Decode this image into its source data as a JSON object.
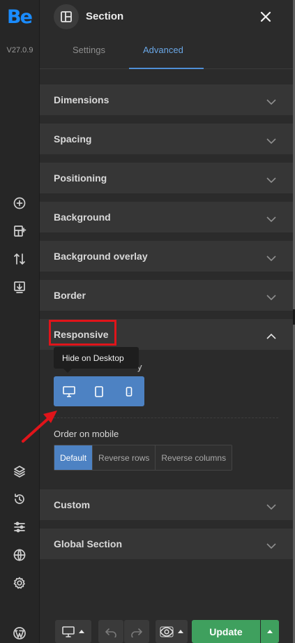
{
  "app": {
    "logo": "Be",
    "version": "V27.0.9"
  },
  "panel": {
    "title": "Section",
    "tabs": [
      {
        "label": "Settings",
        "active": false
      },
      {
        "label": "Advanced",
        "active": true
      }
    ],
    "sections": [
      {
        "label": "Dimensions",
        "expanded": false
      },
      {
        "label": "Spacing",
        "expanded": false
      },
      {
        "label": "Positioning",
        "expanded": false
      },
      {
        "label": "Background",
        "expanded": false
      },
      {
        "label": "Background overlay",
        "expanded": false
      },
      {
        "label": "Border",
        "expanded": false
      },
      {
        "label": "Responsive",
        "expanded": true
      },
      {
        "label": "Custom",
        "expanded": false
      },
      {
        "label": "Global Section",
        "expanded": false
      }
    ],
    "responsive": {
      "tooltip": "Hide on Desktop",
      "visibility_label_tail": "y",
      "devices": [
        "desktop",
        "tablet",
        "mobile"
      ],
      "order_label": "Order on mobile",
      "order_options": [
        "Default",
        "Reverse rows",
        "Reverse columns"
      ],
      "order_selected": "Default"
    }
  },
  "toolbar": {
    "update_label": "Update"
  },
  "colors": {
    "accent_blue": "#4d82c3",
    "tab_active": "#6aa7e6",
    "update_green": "#3fa05e",
    "annotation_red": "#e0141a"
  },
  "rail_icons": [
    "add-circle-icon",
    "add-layout-icon",
    "sort-arrows-icon",
    "import-icon",
    "layers-icon",
    "history-icon",
    "sliders-icon",
    "globe-icon",
    "settings-icon",
    "wordpress-icon"
  ]
}
